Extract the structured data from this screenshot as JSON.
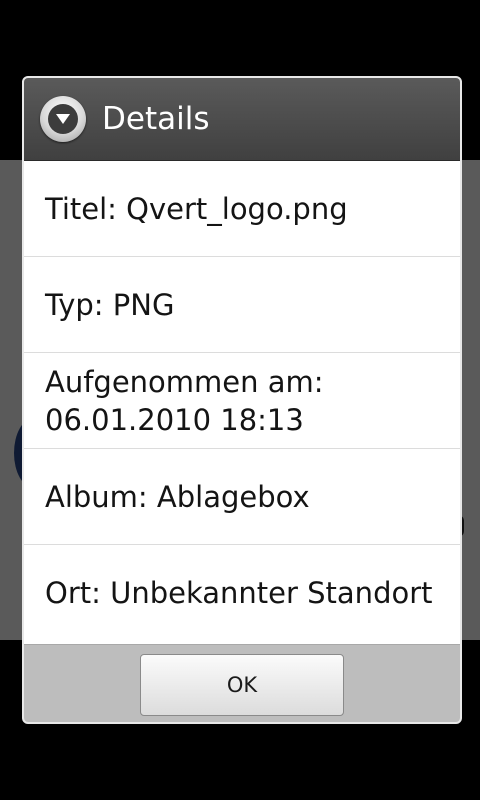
{
  "dialog": {
    "title": "Details",
    "icon": "details-icon"
  },
  "details": [
    {
      "label": "Titel: Qvert_logo.png"
    },
    {
      "label": "Typ: PNG"
    },
    {
      "label": "Aufgenommen am: 06.01.2010 18:13"
    },
    {
      "label": "Album: Ablagebox"
    },
    {
      "label": "Ort: Unbekannter Standort"
    }
  ],
  "buttons": {
    "ok_label": "OK"
  },
  "colors": {
    "header_bg": "#4a4a4a",
    "button_bar_bg": "#bdbdbd",
    "dialog_bg": "#ffffff"
  }
}
